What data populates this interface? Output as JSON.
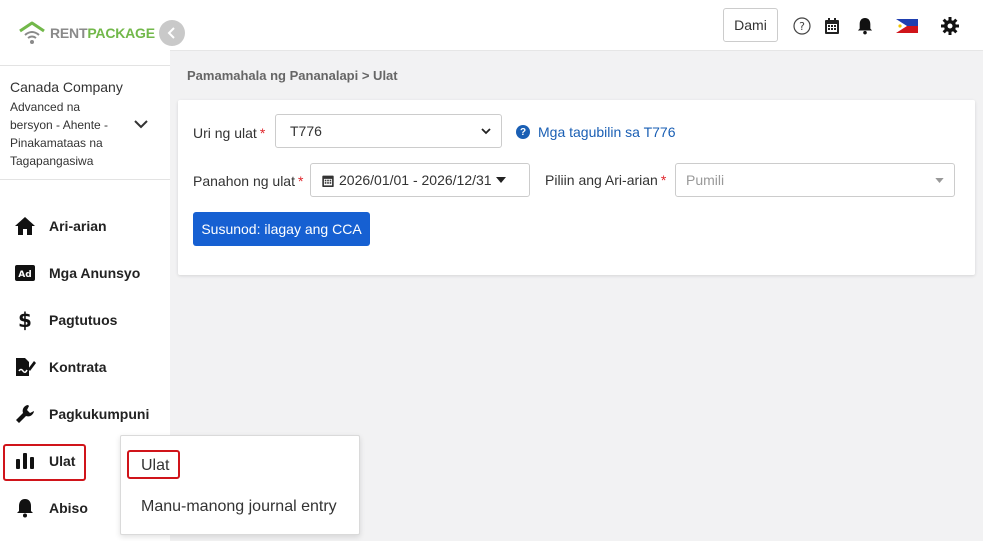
{
  "brand": {
    "logo_text_a": "RENT",
    "logo_text_b": "PACKAGE"
  },
  "company": {
    "name": "Canada Company",
    "role": "Advanced na bersyon - Ahente - Pinakamataas na Tagapangasiwa"
  },
  "sidebar": {
    "items": [
      {
        "label": "Ari-arian",
        "icon": "house-icon"
      },
      {
        "label": "Mga Anunsyo",
        "icon": "ad-icon"
      },
      {
        "label": "Pagtutuos",
        "icon": "dollar-icon"
      },
      {
        "label": "Kontrata",
        "icon": "contract-icon"
      },
      {
        "label": "Pagkukumpuni",
        "icon": "wrench-icon"
      },
      {
        "label": "Ulat",
        "icon": "bar-chart-icon"
      },
      {
        "label": "Abiso",
        "icon": "bell-icon"
      }
    ]
  },
  "topbar": {
    "more_label": "Dami",
    "icons": [
      "help-icon",
      "calendar-icon",
      "bell-icon",
      "philippines-flag-icon",
      "gear-icon"
    ]
  },
  "breadcrumb": "Pamamahala ng Pananalapi > Ulat",
  "form": {
    "report_type_label": "Uri ng ulat",
    "report_type_value": "T776",
    "help_link": "Mga tagubilin sa T776",
    "period_label": "Panahon ng ulat",
    "period_value": "2026/01/01 - 2026/12/31",
    "property_label": "Piliin ang Ari-arian",
    "property_placeholder": "Pumili",
    "required_mark": "*",
    "next_button": "Susunod: ilagay ang CCA"
  },
  "submenu": {
    "items": [
      "Ulat",
      "Manu-manong journal entry"
    ]
  },
  "colors": {
    "primary": "#1660d2",
    "link": "#1a5fb4",
    "brand_green": "#72b84a",
    "highlight_red": "#d0141a"
  }
}
